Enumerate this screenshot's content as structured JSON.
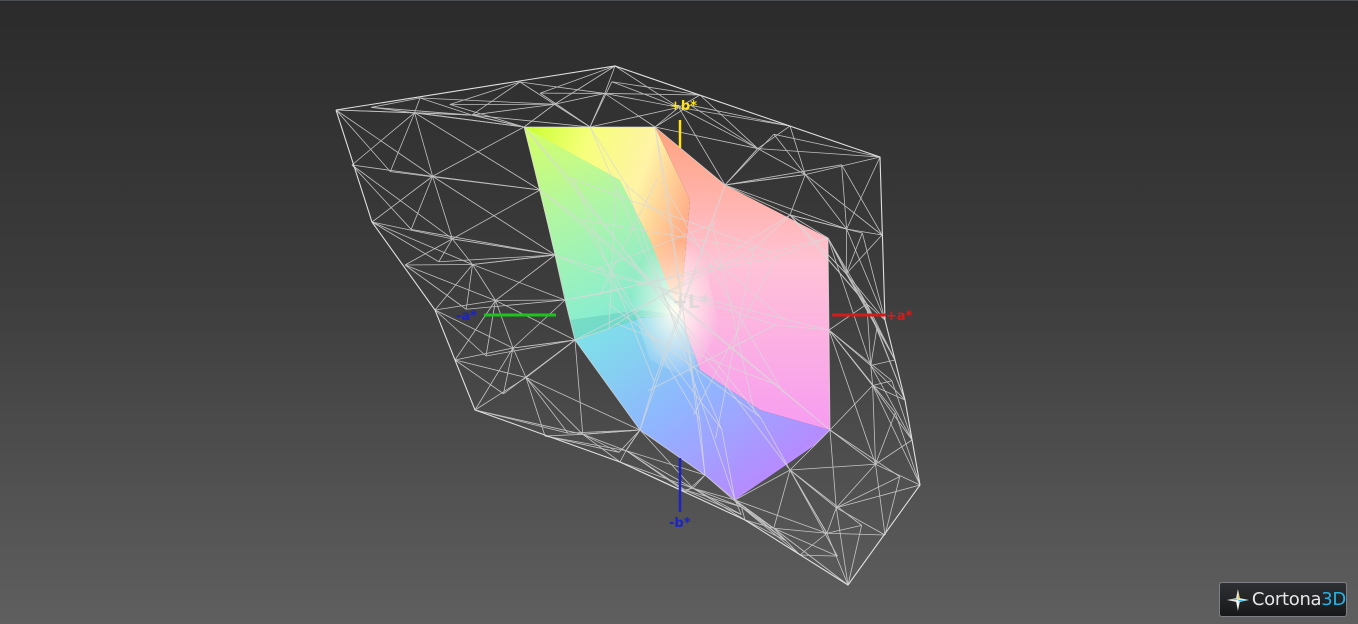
{
  "viewer": {
    "axes": {
      "plus_b": "+b*",
      "minus_b": "-b*",
      "plus_a": "+a*",
      "minus_a": "-a*",
      "plus_L": "+L*"
    },
    "colors": {
      "axis_plus_b": "#ffe21a",
      "axis_minus_b": "#1c22c8",
      "axis_plus_a": "#d81a1a",
      "axis_minus_a": "#1fc21f",
      "wireframe": "#d9d9d9",
      "background_top": "#2b2b2b",
      "background_bottom": "#5f5f5f"
    }
  },
  "branding": {
    "name_main": "Cortona",
    "name_accent": "3D",
    "logo_icon": "cortona-star-icon"
  }
}
